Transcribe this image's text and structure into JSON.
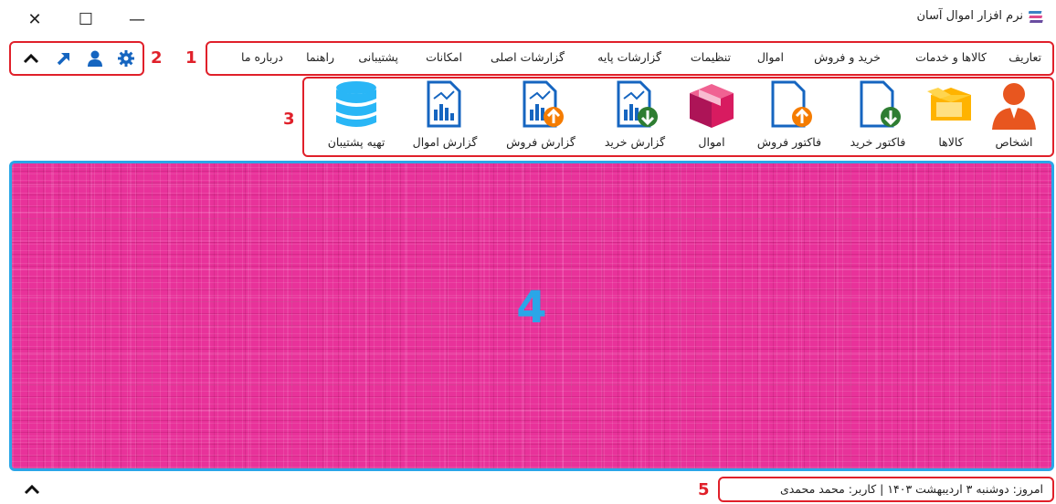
{
  "window": {
    "title": "نرم افزار اموال آسان",
    "controls": {
      "close": "✕",
      "maximize": "☐",
      "minimize": "—"
    }
  },
  "annotations": {
    "n1": "1",
    "n2": "2",
    "n3": "3",
    "n4": "4",
    "n5": "5"
  },
  "colors": {
    "annotation_red": "#e0202a",
    "main_pink": "#e8329a",
    "main_border_blue": "#2aa6e8",
    "icon_blue": "#1565c0",
    "icon_orange": "#f57c00",
    "icon_green": "#2e7d32"
  },
  "menu": {
    "items": [
      {
        "label": "تعاریف"
      },
      {
        "label": "کالاها و خدمات"
      },
      {
        "label": "خرید و فروش"
      },
      {
        "label": "اموال"
      },
      {
        "label": "تنظیمات"
      },
      {
        "label": "گزارشات پایه"
      },
      {
        "label": "گزارشات اصلی"
      },
      {
        "label": "امکانات"
      },
      {
        "label": "پشتیبانی"
      },
      {
        "label": "راهنما"
      },
      {
        "label": "درباره ما"
      }
    ]
  },
  "quick_tools": [
    {
      "icon": "gear-icon"
    },
    {
      "icon": "user-icon"
    },
    {
      "icon": "arrow-up-right-icon"
    },
    {
      "icon": "chevron-up-icon"
    }
  ],
  "toolbar": {
    "buttons": [
      {
        "label": "اشخاص",
        "icon": "person-icon"
      },
      {
        "label": "کالاها",
        "icon": "box-icon"
      },
      {
        "label": "فاکتور خرید",
        "icon": "invoice-download-icon"
      },
      {
        "label": "فاکتور فروش",
        "icon": "invoice-upload-icon"
      },
      {
        "label": "اموال",
        "icon": "assets-box-icon"
      },
      {
        "label": "گزارش خرید",
        "icon": "report-download-icon"
      },
      {
        "label": "گزارش فروش",
        "icon": "report-upload-icon"
      },
      {
        "label": "گزارش اموال",
        "icon": "report-icon"
      },
      {
        "label": "تهیه پشتیبان",
        "icon": "database-icon"
      }
    ]
  },
  "status": {
    "text": "امروز: دوشنبه ۳ اردیبهشت ۱۴۰۳   |   کاربر: محمد محمدی",
    "collapse_glyph": "⌃"
  }
}
